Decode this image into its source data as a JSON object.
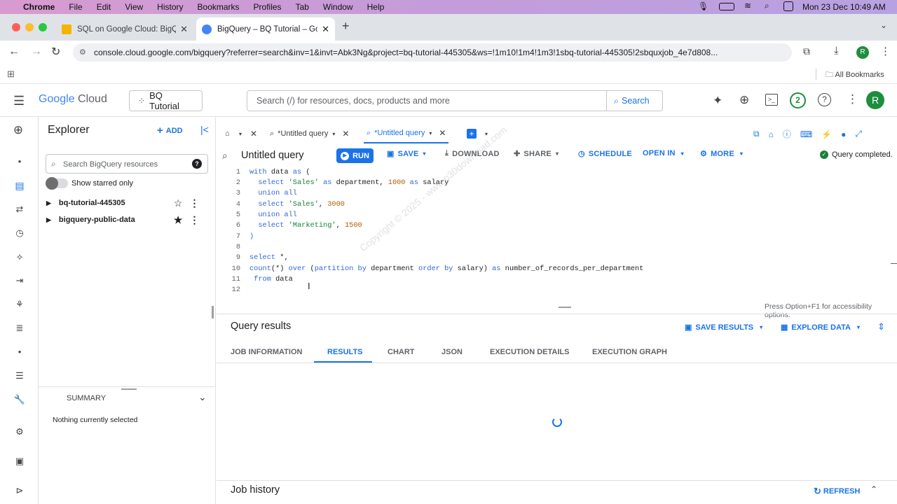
{
  "macos": {
    "menu": [
      "File",
      "Edit",
      "View",
      "History",
      "Bookmarks",
      "Profiles",
      "Tab",
      "Window",
      "Help"
    ],
    "app": "Chrome",
    "clock": "Mon 23 Dec  10:49 AM"
  },
  "browser": {
    "tabs": [
      {
        "title": "SQL on Google Cloud: BigQu",
        "active": false,
        "favicon_color": "#f4b400"
      },
      {
        "title": "BigQuery – BQ Tutorial – Goo",
        "active": true,
        "favicon_color": "#4285f4"
      }
    ],
    "url": "console.cloud.google.com/bigquery?referrer=search&inv=1&invt=Abk3Ng&project=bq-tutorial-445305&ws=!1m10!1m4!1m3!1sbq-tutorial-445305!2sbquxjob_4e7d808...",
    "profile_initial": "R",
    "all_bookmarks": "All Bookmarks"
  },
  "gcp": {
    "logo_google": "Google",
    "logo_cloud": "Cloud",
    "project": "BQ Tutorial",
    "search_placeholder": "Search (/) for resources, docs, products and more",
    "search_button": "Search",
    "notifications": "2",
    "avatar": "R"
  },
  "explorer": {
    "title": "Explorer",
    "add": "ADD",
    "search_placeholder": "Search BigQuery resources",
    "starred_toggle": "Show starred only",
    "items": [
      {
        "name": "bq-tutorial-445305",
        "starred": false
      },
      {
        "name": "bigquery-public-data",
        "starred": true
      }
    ],
    "summary": "SUMMARY",
    "nothing_selected": "Nothing currently selected"
  },
  "editor": {
    "tabs": [
      "*Untitled query",
      "*Untitled query"
    ],
    "title": "Untitled query",
    "actions": {
      "run": "RUN",
      "save": "SAVE",
      "download": "DOWNLOAD",
      "share": "SHARE",
      "schedule": "SCHEDULE",
      "open_in": "OPEN IN",
      "more": "MORE"
    },
    "status": "Query completed.",
    "line_numbers": [
      "1",
      "2",
      "3",
      "4",
      "5",
      "6",
      "7",
      "8",
      "9",
      "10",
      "11",
      "12"
    ],
    "accessibility_hint": "Press Option+F1 for accessibility options."
  },
  "results": {
    "title": "Query results",
    "save_results": "SAVE RESULTS",
    "explore_data": "EXPLORE DATA",
    "tabs": [
      "JOB INFORMATION",
      "RESULTS",
      "CHART",
      "JSON",
      "EXECUTION DETAILS",
      "EXECUTION GRAPH"
    ],
    "active_tab": "RESULTS",
    "job_history": "Job history",
    "refresh": "REFRESH"
  },
  "watermark": "Copyright © 2025 - www.p30download.com",
  "colors": {
    "accent": "#1a73e8",
    "run_button": "#1a73e8",
    "success": "#188038"
  }
}
